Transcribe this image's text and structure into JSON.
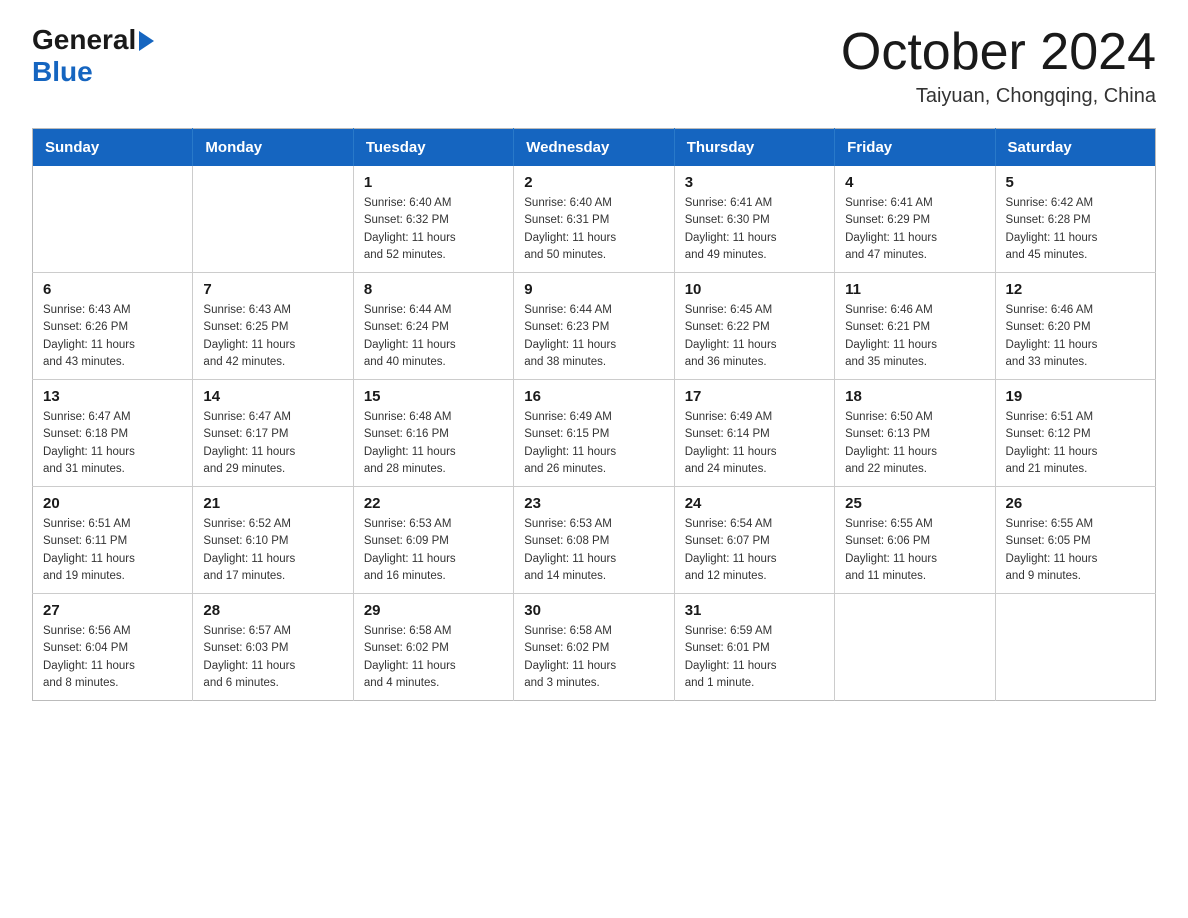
{
  "header": {
    "logo_general": "General",
    "logo_blue": "Blue",
    "title": "October 2024",
    "subtitle": "Taiyuan, Chongqing, China"
  },
  "days_of_week": [
    "Sunday",
    "Monday",
    "Tuesday",
    "Wednesday",
    "Thursday",
    "Friday",
    "Saturday"
  ],
  "weeks": [
    [
      {
        "day": "",
        "info": ""
      },
      {
        "day": "",
        "info": ""
      },
      {
        "day": "1",
        "info": "Sunrise: 6:40 AM\nSunset: 6:32 PM\nDaylight: 11 hours\nand 52 minutes."
      },
      {
        "day": "2",
        "info": "Sunrise: 6:40 AM\nSunset: 6:31 PM\nDaylight: 11 hours\nand 50 minutes."
      },
      {
        "day": "3",
        "info": "Sunrise: 6:41 AM\nSunset: 6:30 PM\nDaylight: 11 hours\nand 49 minutes."
      },
      {
        "day": "4",
        "info": "Sunrise: 6:41 AM\nSunset: 6:29 PM\nDaylight: 11 hours\nand 47 minutes."
      },
      {
        "day": "5",
        "info": "Sunrise: 6:42 AM\nSunset: 6:28 PM\nDaylight: 11 hours\nand 45 minutes."
      }
    ],
    [
      {
        "day": "6",
        "info": "Sunrise: 6:43 AM\nSunset: 6:26 PM\nDaylight: 11 hours\nand 43 minutes."
      },
      {
        "day": "7",
        "info": "Sunrise: 6:43 AM\nSunset: 6:25 PM\nDaylight: 11 hours\nand 42 minutes."
      },
      {
        "day": "8",
        "info": "Sunrise: 6:44 AM\nSunset: 6:24 PM\nDaylight: 11 hours\nand 40 minutes."
      },
      {
        "day": "9",
        "info": "Sunrise: 6:44 AM\nSunset: 6:23 PM\nDaylight: 11 hours\nand 38 minutes."
      },
      {
        "day": "10",
        "info": "Sunrise: 6:45 AM\nSunset: 6:22 PM\nDaylight: 11 hours\nand 36 minutes."
      },
      {
        "day": "11",
        "info": "Sunrise: 6:46 AM\nSunset: 6:21 PM\nDaylight: 11 hours\nand 35 minutes."
      },
      {
        "day": "12",
        "info": "Sunrise: 6:46 AM\nSunset: 6:20 PM\nDaylight: 11 hours\nand 33 minutes."
      }
    ],
    [
      {
        "day": "13",
        "info": "Sunrise: 6:47 AM\nSunset: 6:18 PM\nDaylight: 11 hours\nand 31 minutes."
      },
      {
        "day": "14",
        "info": "Sunrise: 6:47 AM\nSunset: 6:17 PM\nDaylight: 11 hours\nand 29 minutes."
      },
      {
        "day": "15",
        "info": "Sunrise: 6:48 AM\nSunset: 6:16 PM\nDaylight: 11 hours\nand 28 minutes."
      },
      {
        "day": "16",
        "info": "Sunrise: 6:49 AM\nSunset: 6:15 PM\nDaylight: 11 hours\nand 26 minutes."
      },
      {
        "day": "17",
        "info": "Sunrise: 6:49 AM\nSunset: 6:14 PM\nDaylight: 11 hours\nand 24 minutes."
      },
      {
        "day": "18",
        "info": "Sunrise: 6:50 AM\nSunset: 6:13 PM\nDaylight: 11 hours\nand 22 minutes."
      },
      {
        "day": "19",
        "info": "Sunrise: 6:51 AM\nSunset: 6:12 PM\nDaylight: 11 hours\nand 21 minutes."
      }
    ],
    [
      {
        "day": "20",
        "info": "Sunrise: 6:51 AM\nSunset: 6:11 PM\nDaylight: 11 hours\nand 19 minutes."
      },
      {
        "day": "21",
        "info": "Sunrise: 6:52 AM\nSunset: 6:10 PM\nDaylight: 11 hours\nand 17 minutes."
      },
      {
        "day": "22",
        "info": "Sunrise: 6:53 AM\nSunset: 6:09 PM\nDaylight: 11 hours\nand 16 minutes."
      },
      {
        "day": "23",
        "info": "Sunrise: 6:53 AM\nSunset: 6:08 PM\nDaylight: 11 hours\nand 14 minutes."
      },
      {
        "day": "24",
        "info": "Sunrise: 6:54 AM\nSunset: 6:07 PM\nDaylight: 11 hours\nand 12 minutes."
      },
      {
        "day": "25",
        "info": "Sunrise: 6:55 AM\nSunset: 6:06 PM\nDaylight: 11 hours\nand 11 minutes."
      },
      {
        "day": "26",
        "info": "Sunrise: 6:55 AM\nSunset: 6:05 PM\nDaylight: 11 hours\nand 9 minutes."
      }
    ],
    [
      {
        "day": "27",
        "info": "Sunrise: 6:56 AM\nSunset: 6:04 PM\nDaylight: 11 hours\nand 8 minutes."
      },
      {
        "day": "28",
        "info": "Sunrise: 6:57 AM\nSunset: 6:03 PM\nDaylight: 11 hours\nand 6 minutes."
      },
      {
        "day": "29",
        "info": "Sunrise: 6:58 AM\nSunset: 6:02 PM\nDaylight: 11 hours\nand 4 minutes."
      },
      {
        "day": "30",
        "info": "Sunrise: 6:58 AM\nSunset: 6:02 PM\nDaylight: 11 hours\nand 3 minutes."
      },
      {
        "day": "31",
        "info": "Sunrise: 6:59 AM\nSunset: 6:01 PM\nDaylight: 11 hours\nand 1 minute."
      },
      {
        "day": "",
        "info": ""
      },
      {
        "day": "",
        "info": ""
      }
    ]
  ]
}
